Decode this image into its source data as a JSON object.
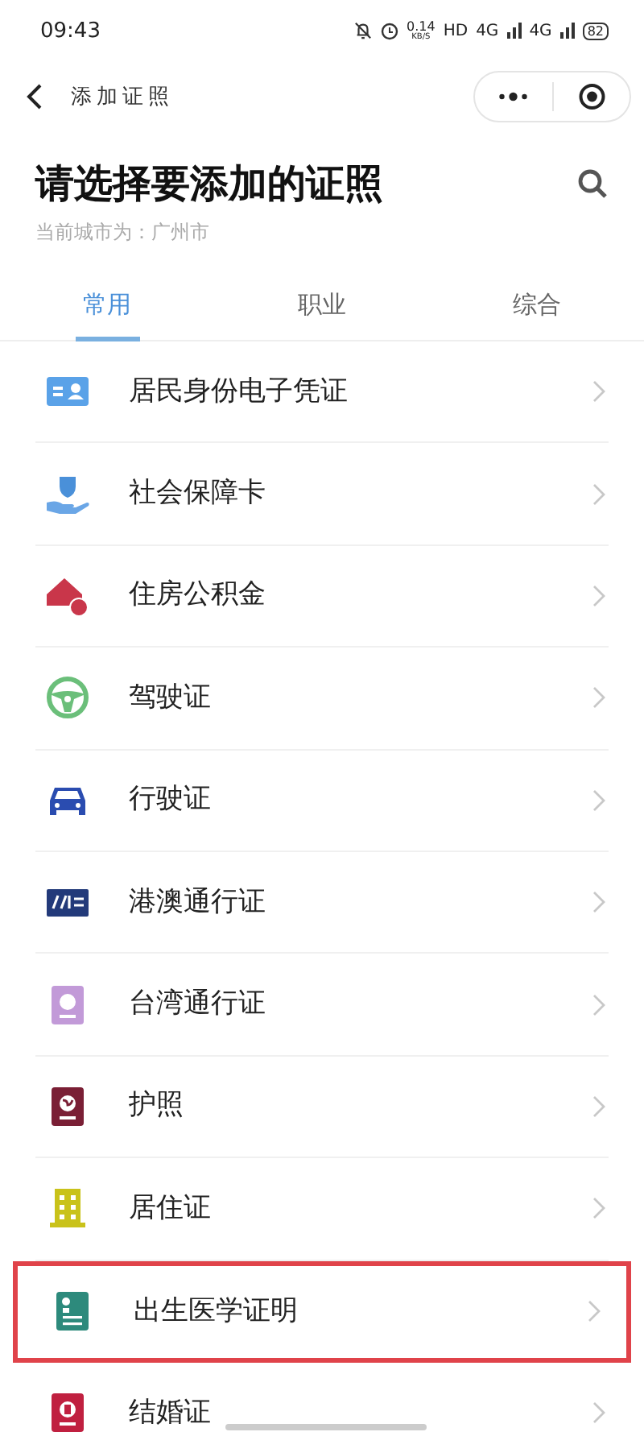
{
  "status_bar": {
    "time": "09:43",
    "speed": "0.14",
    "speed_unit": "KB/S",
    "hd": "HD",
    "network_1": "4G",
    "network_2": "4G",
    "battery": "82"
  },
  "nav_bar": {
    "title": "添加证照"
  },
  "header": {
    "title": "请选择要添加的证照",
    "subtitle": "当前城市为：广州市"
  },
  "tabs": [
    {
      "label": "常用",
      "selected": true
    },
    {
      "label": "职业",
      "selected": false
    },
    {
      "label": "综合",
      "selected": false
    }
  ],
  "items": [
    {
      "kind": "id-card",
      "label": "居民身份电子凭证",
      "highlighted": false
    },
    {
      "kind": "social-security",
      "label": "社会保障卡",
      "highlighted": false
    },
    {
      "kind": "housing-fund",
      "label": "住房公积金",
      "highlighted": false
    },
    {
      "kind": "driver-license",
      "label": "驾驶证",
      "highlighted": false
    },
    {
      "kind": "vehicle-license",
      "label": "行驶证",
      "highlighted": false
    },
    {
      "kind": "hk-macau-permit",
      "label": "港澳通行证",
      "highlighted": false
    },
    {
      "kind": "taiwan-permit",
      "label": "台湾通行证",
      "highlighted": false
    },
    {
      "kind": "passport",
      "label": "护照",
      "highlighted": false
    },
    {
      "kind": "residence-permit",
      "label": "居住证",
      "highlighted": false
    },
    {
      "kind": "birth-certificate",
      "label": "出生医学证明",
      "highlighted": true
    },
    {
      "kind": "marriage-certificate",
      "label": "结婚证",
      "highlighted": false
    }
  ]
}
